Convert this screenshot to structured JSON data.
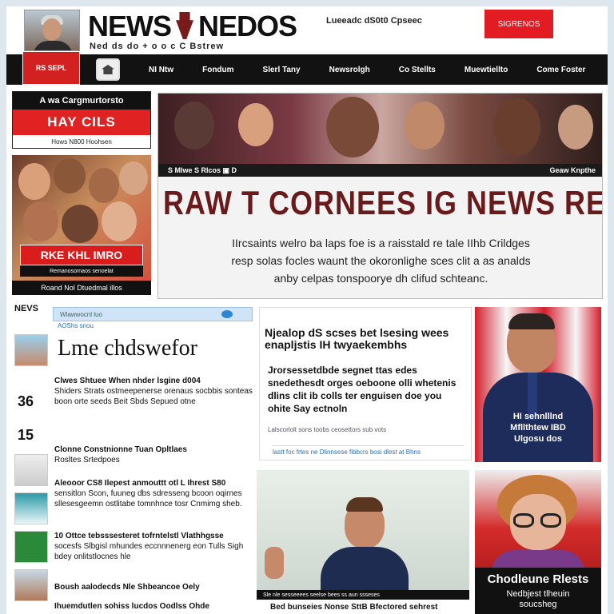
{
  "header": {
    "brand_left": "NEWS",
    "brand_right": "NEDOS",
    "tagline": "Ned ds do + o o c C Bstrew",
    "info": "Lueeadc dS0t0 Cpseec",
    "subscribe_label": "SIGRENOS"
  },
  "live_badge": "RS SEPL",
  "nav": {
    "items": [
      "NI Ntw",
      "Fondum",
      "Slerl Tany",
      "Newsrolgh",
      "Co Stellts",
      "Muewtiellto",
      "Come Foster"
    ]
  },
  "promo": {
    "title": "A wa Cargmurtorsto",
    "red_label": "HAY CILS",
    "sub": "Hows  N800 Hoohsen"
  },
  "kids_panel": {
    "banner": "RKE KHL IMRO",
    "sub": "Remanosornaos senoelat",
    "caption": "Roand Nol Dtuedmal illos"
  },
  "hero": {
    "ticker_left": "S Mlwe   S Rlcos  ▣ D",
    "ticker_right": "Geaw Knpthe",
    "headline": "RAW T CORNEES IG NEWS RELIRSE",
    "body": [
      "IIrcsaints  welro ba laps  foe is a raisstald re tale IIhb Crildges",
      "resp solas focles waunt the okoronlighe sces clit a as analds",
      "anby celpas tonspoorye dh clifud schteanc."
    ]
  },
  "feed": {
    "label": "NEVS",
    "search_text": "Wlawwocnl luo",
    "tag": "AOShs snou",
    "headline": "Lme chdswefor",
    "num1": "36",
    "num2": "15",
    "items": [
      {
        "title": "Clwes Shtuee  When nhder lsgine d004",
        "body": "Shiders Strats ostmeepenerse orenaus socbbis sonteas boon orte seeds Beit Sbds Sepued otne"
      },
      {
        "title": "Clonne Constnionne Tuan Opltlaes",
        "body": "Rosltes Srtedpoes"
      },
      {
        "title": "Aleooor CS8 Ilepest anmouttt otl L Ihrest S80",
        "body": "sensitlon Scon, fuuneg dbs sdresseng bcoon oqirnes sllesesgeemn ostlitabe tomnhnce tosr Cnmimg sheb."
      },
      {
        "title": "10 Ottce tebsssesteret tofrntelstl Vlathhgsse",
        "body": "socesfs Slbgisl mhundes eccnnnenerg eon Tulls Sigh bdey onlitstlocnes hle"
      },
      {
        "title": "Boush aalodecds Nle Shbeancoe Oely",
        "body": ""
      },
      {
        "title": "Ihuemdutlen sohiss lucdos Oodlss Ohde",
        "body": ""
      }
    ]
  },
  "mid_card": {
    "head": "Njealop dS scses bet lsesing wees enapljstis IH twyaekembhs",
    "body": "Jrorsessetdbde segnet ttas edes snedethesdt orges oeboone olli whetenis dlins clit ib colls ter enguisen doe you ohite Say ectnoln",
    "foot": "Lalscorlolt sons toobs ceosettors                    sub vots",
    "link": "lastt foc frtes ne Dlinnsese fibbcrs bosi dlest at Bhns"
  },
  "mid_photo_caption": "Sle nle sesseeees   seelse bees ss aun ssseses",
  "bottom_headline": "Bed bunseies Nonse SttB Bfectored sehrest",
  "right_card": {
    "caption_line1": "HI sehnlllnd",
    "caption_line2": "Mfllthtew IBD",
    "caption_line3": "Ulgosu  dos"
  },
  "kid_card": {
    "title": "Chodleune Rlests",
    "sub1": "Nedbjest tlheuin",
    "sub2": "soucsheg"
  },
  "colors": {
    "accent_red": "#e31b23",
    "nav_bg": "#121212",
    "hero_headline": "#6a1a1a",
    "link_blue": "#2a6fb2"
  }
}
